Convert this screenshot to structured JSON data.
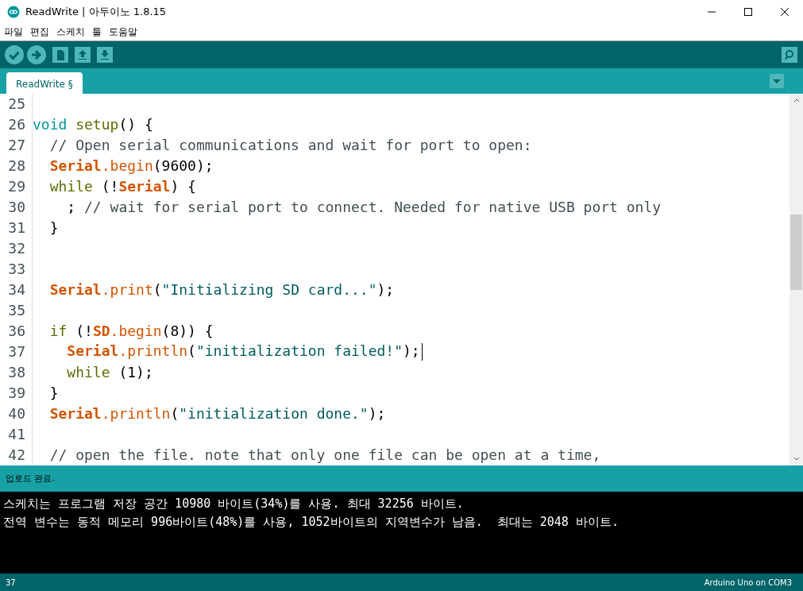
{
  "window": {
    "title": "ReadWrite | 아두이노 1.8.15"
  },
  "menu": [
    "파일",
    "편집",
    "스케치",
    "툴",
    "도움말"
  ],
  "tabs": [
    {
      "label": "ReadWrite §",
      "selected": true
    }
  ],
  "editor": {
    "lines": [
      {
        "number": "25",
        "cursor": false
      },
      {
        "number": "26",
        "cursor": false,
        "tokens": [
          {
            "kind": "type",
            "text": "void"
          },
          {
            "kind": "func",
            "text": " setup"
          },
          {
            "kind": "plain",
            "text": "() {"
          }
        ]
      },
      {
        "number": "27",
        "cursor": false,
        "tokens": [
          {
            "kind": "comment",
            "text": "  // Open serial communications and wait for port to open:"
          }
        ]
      },
      {
        "number": "28",
        "cursor": false,
        "tokens": [
          {
            "kind": "class",
            "text": "  Serial"
          },
          {
            "kind": "method",
            "text": ".begin"
          },
          {
            "kind": "plain",
            "text": "(9600);"
          }
        ]
      },
      {
        "number": "29",
        "cursor": false,
        "tokens": [
          {
            "kind": "func",
            "text": "  while"
          },
          {
            "kind": "plain",
            "text": " (!"
          },
          {
            "kind": "class",
            "text": "Serial"
          },
          {
            "kind": "plain",
            "text": ") {"
          }
        ]
      },
      {
        "number": "30",
        "cursor": false,
        "tokens": [
          {
            "kind": "plain",
            "text": "    ; "
          },
          {
            "kind": "comment",
            "text": "// wait for serial port to connect. Needed for native USB port only"
          }
        ]
      },
      {
        "number": "31",
        "cursor": false,
        "tokens": [
          {
            "kind": "plain",
            "text": "  }"
          }
        ]
      },
      {
        "number": "32",
        "cursor": false
      },
      {
        "number": "33",
        "cursor": false
      },
      {
        "number": "34",
        "cursor": false,
        "tokens": [
          {
            "kind": "class",
            "text": "  Serial"
          },
          {
            "kind": "method",
            "text": ".print"
          },
          {
            "kind": "plain",
            "text": "("
          },
          {
            "kind": "string",
            "text": "\"Initializing SD card...\""
          },
          {
            "kind": "plain",
            "text": ");"
          }
        ]
      },
      {
        "number": "35",
        "cursor": false
      },
      {
        "number": "36",
        "cursor": false,
        "tokens": [
          {
            "kind": "func",
            "text": "  if"
          },
          {
            "kind": "plain",
            "text": " (!"
          },
          {
            "kind": "class",
            "text": "SD"
          },
          {
            "kind": "method",
            "text": ".begin"
          },
          {
            "kind": "plain",
            "text": "(8)) {"
          }
        ]
      },
      {
        "number": "37",
        "cursor": true,
        "tokens": [
          {
            "kind": "class",
            "text": "    Serial"
          },
          {
            "kind": "method",
            "text": ".println"
          },
          {
            "kind": "plain",
            "text": "("
          },
          {
            "kind": "string",
            "text": "\"initialization failed!\""
          },
          {
            "kind": "plain",
            "text": ");"
          }
        ]
      },
      {
        "number": "38",
        "cursor": false,
        "tokens": [
          {
            "kind": "func",
            "text": "    while"
          },
          {
            "kind": "plain",
            "text": " (1);"
          }
        ]
      },
      {
        "number": "39",
        "cursor": false,
        "tokens": [
          {
            "kind": "plain",
            "text": "  }"
          }
        ]
      },
      {
        "number": "40",
        "cursor": false,
        "tokens": [
          {
            "kind": "class",
            "text": "  Serial"
          },
          {
            "kind": "method",
            "text": ".println"
          },
          {
            "kind": "plain",
            "text": "("
          },
          {
            "kind": "string",
            "text": "\"initialization done.\""
          },
          {
            "kind": "plain",
            "text": ");"
          }
        ]
      },
      {
        "number": "41",
        "cursor": false
      },
      {
        "number": "42",
        "cursor": false,
        "tokens": [
          {
            "kind": "comment",
            "text": "  // open the file. note that only one file can be open at a time,"
          }
        ]
      }
    ]
  },
  "status": "업로드 완료.",
  "console": [
    "스케치는 프로그램 저장 공간 10980 바이트(34%)를 사용. 최대 32256 바이트.",
    "전역 변수는 동적 메모리 996바이트(48%)를 사용, 1052바이트의 지역변수가 남음.  최대는 2048 바이트."
  ],
  "status_bar": {
    "line": "37",
    "board": "Arduino Uno on COM3"
  }
}
